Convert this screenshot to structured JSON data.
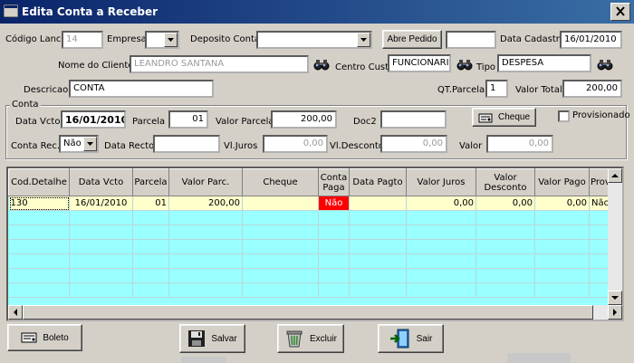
{
  "window": {
    "title": "Edita Conta a Receber"
  },
  "header": {
    "codigo_lanc_label": "Código Lanc.",
    "codigo_lanc_value": "14",
    "empresa_label": "Empresa",
    "empresa_value": "",
    "deposito_label": "Deposito Conta",
    "deposito_value": "",
    "abre_pedido_label": "Abre Pedido",
    "abre_pedido_value": "",
    "data_cadastro_label": "Data Cadastro",
    "data_cadastro_value": "16/01/2010",
    "nome_cliente_label": "Nome do Cliente",
    "nome_cliente_value": "LEANDRO SANTANA",
    "centro_custo_label": "Centro Custo",
    "centro_custo_value": "FUNCIONARI",
    "tipo_label": "Tipo",
    "tipo_value": "DESPESA",
    "descricao_label": "Descricao",
    "descricao_value": "CONTA",
    "qt_parcela_label": "QT.Parcela",
    "qt_parcela_value": "1",
    "valor_total_label": "Valor Total",
    "valor_total_value": "200,00"
  },
  "conta_group": {
    "title": "Conta",
    "data_vcto_label": "Data Vcto",
    "data_vcto_value": "16/01/2010",
    "parcela_label": "Parcela",
    "parcela_value": "01",
    "valor_parcela_label": "Valor Parcela",
    "valor_parcela_value": "200,00",
    "doc2_label": "Doc2",
    "doc2_value": "",
    "cheque_button": "Cheque",
    "provisionado_label": "Provisionado",
    "provisionado_checked": false,
    "conta_rec_label": "Conta Rec.",
    "conta_rec_value": "Não",
    "data_recto_label": "Data Recto",
    "data_recto_value": "",
    "vl_juros_label": "Vl.Juros",
    "vl_juros_value": "0,00",
    "vl_desconto_label": "Vl.Desconto",
    "vl_desconto_value": "0,00",
    "valor_label": "Valor",
    "valor_value": "0,00"
  },
  "grid": {
    "columns": [
      "Cod.Detalhe",
      "Data Vcto",
      "Parcela",
      "Valor Parc.",
      "Cheque",
      "Conta Paga",
      "Data Pagto",
      "Valor Juros",
      "Valor Desconto",
      "Valor Pago",
      "Prov"
    ],
    "rows": [
      {
        "cod_detalhe": "130",
        "data_vcto": "16/01/2010",
        "parcela": "01",
        "valor_parc": "200,00",
        "cheque": "",
        "conta_paga": "Não",
        "data_pagto": "",
        "valor_juros": "0,00",
        "valor_desconto": "0,00",
        "valor_pago": "0,00",
        "prov": "Não"
      }
    ]
  },
  "buttons": {
    "boleto": "Boleto",
    "salvar": "Salvar",
    "excluir": "Excluir",
    "sair": "Sair"
  },
  "colors": {
    "title_start": "#0a246a",
    "title_end": "#3a6ea5",
    "grid_background": "#99ffff",
    "selected_row": "#ffffcc",
    "unpaid_cell": "#ff0000",
    "window_face": "#d4d0c8"
  },
  "icons": {
    "search": "binoculars-icon",
    "cheque": "cheque-icon",
    "boleto": "boleto-icon",
    "salvar": "floppy-disk-icon",
    "excluir": "trash-can-icon",
    "sair": "exit-door-icon"
  }
}
